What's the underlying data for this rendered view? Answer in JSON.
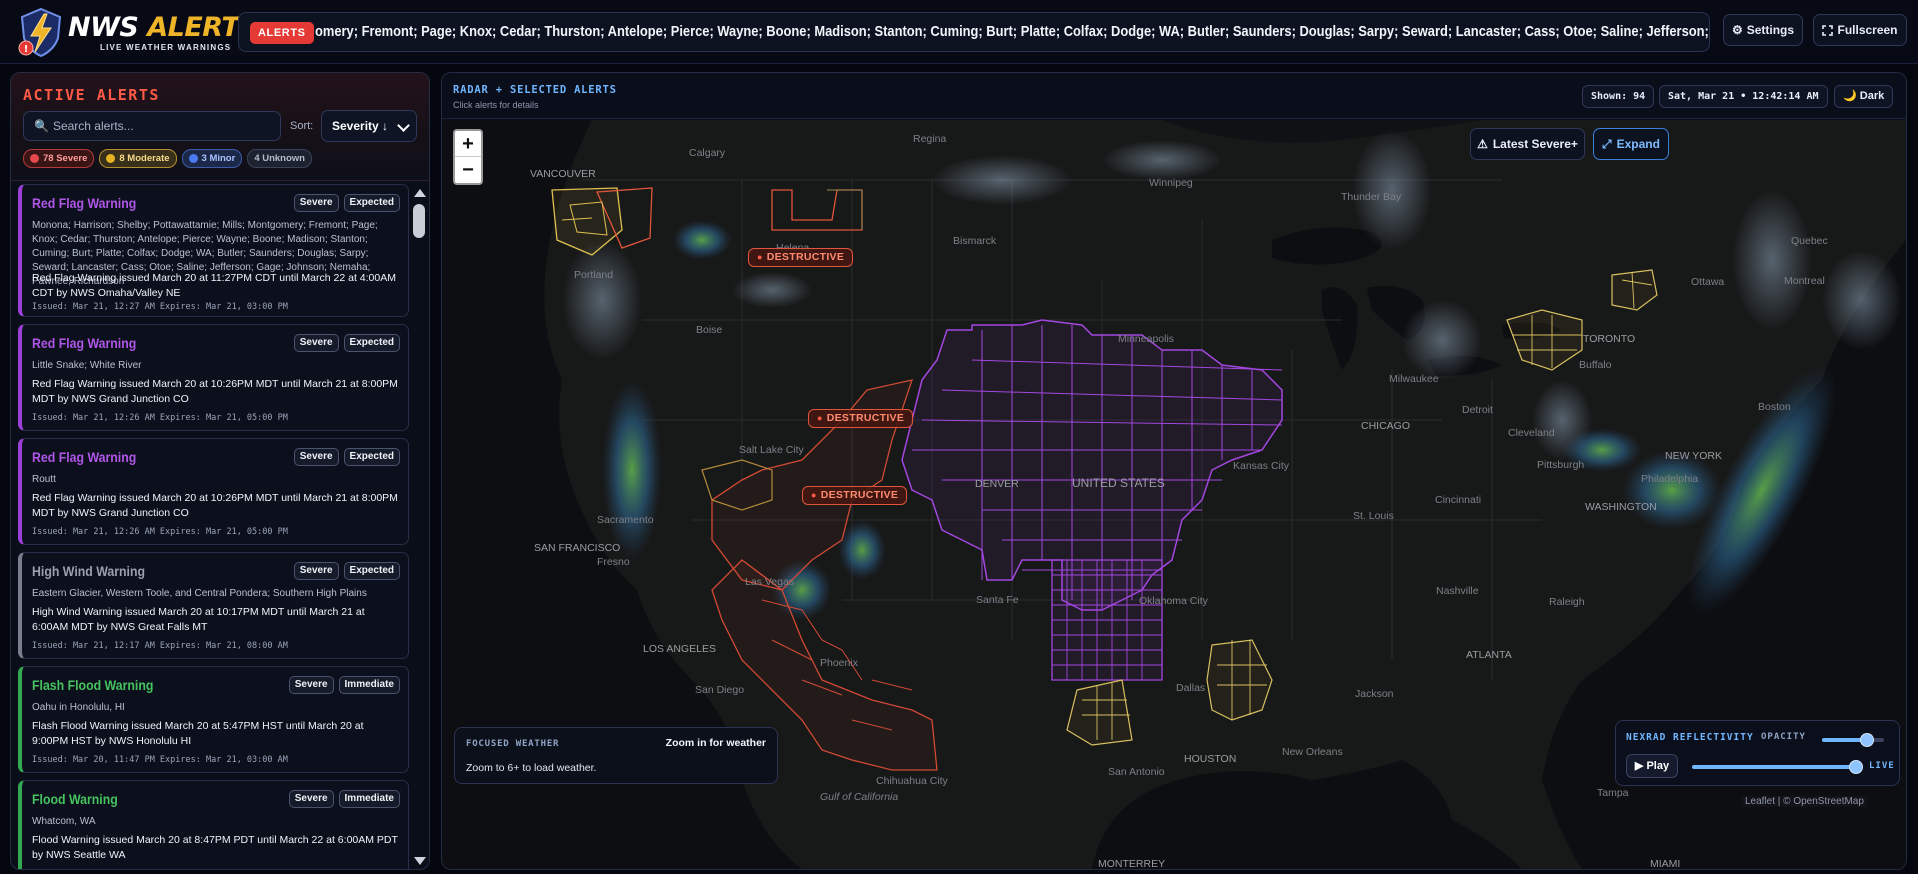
{
  "header": {
    "logo_word1": "NWS",
    "logo_word2": "ALERTS",
    "logo_subtitle": "LIVE WEATHER WARNINGS",
    "ticker_badge": "ALERTS",
    "ticker_text": "omery; Fremont; Page; Knox; Cedar; Thurston; Antelope; Pierce; Wayne; Boone; Madison; Stanton; Cuming; Burt; Platte; Colfax; Dodge; WA; Butler; Saunders; Douglas; Sarpy; Seward; Lancaster; Cass; Otoe; Saline; Jefferson; Gage; Johnson; Nemaha; Pa",
    "settings_label": "Settings",
    "fullscreen_label": "Fullscreen"
  },
  "sidebar": {
    "title": "ACTIVE ALERTS",
    "search_placeholder": "Search alerts...",
    "sort_label": "Sort:",
    "sort_value": "Severity ↓",
    "counts": [
      {
        "label": "78 Severe",
        "color": "#e5484d"
      },
      {
        "label": "8 Moderate",
        "color": "#e6b422"
      },
      {
        "label": "3 Minor",
        "color": "#4a7bf0"
      },
      {
        "label": "4 Unknown",
        "color": ""
      }
    ],
    "alerts": [
      {
        "title": "Red Flag Warning",
        "severity": "Severe",
        "urgency": "Expected",
        "areas": "Monona; Harrison; Shelby; Pottawattamie; Mills; Montgomery; Fremont; Page; Knox; Cedar; Thurston; Antelope; Pierce; Wayne; Boone; Madison; Stanton; Cuming; Burt; Platte; Colfax; Dodge; WA; Butler; Saunders; Douglas; Sarpy; Seward; Lancaster; Cass; Otoe; Saline; Jefferson; Gage; Johnson; Nemaha; Pawnee; Richardson",
        "description": "Red Flag Warning issued March 20 at 11:27PM CDT until March 22 at 4:00AM CDT by NWS Omaha/Valley NE",
        "dates": "Issued: Mar 21, 12:27 AM Expires: Mar 21, 03:00 PM"
      },
      {
        "title": "Red Flag Warning",
        "severity": "Severe",
        "urgency": "Expected",
        "areas": "Little Snake; White River",
        "description": "Red Flag Warning issued March 20 at 10:26PM MDT until March 21 at 8:00PM MDT by NWS Grand Junction CO",
        "dates": "Issued: Mar 21, 12:26 AM Expires: Mar 21, 05:00 PM"
      },
      {
        "title": "Red Flag Warning",
        "severity": "Severe",
        "urgency": "Expected",
        "areas": "Routt",
        "description": "Red Flag Warning issued March 20 at 10:26PM MDT until March 21 at 8:00PM MDT by NWS Grand Junction CO",
        "dates": "Issued: Mar 21, 12:26 AM Expires: Mar 21, 05:00 PM"
      },
      {
        "title": "High Wind Warning",
        "severity": "Severe",
        "urgency": "Expected",
        "areas": "Eastern Glacier, Western Toole, and Central Pondera; Southern High Plains",
        "description": "High Wind Warning issued March 20 at 10:17PM MDT until March 21 at 6:00AM MDT by NWS Great Falls MT",
        "dates": "Issued: Mar 21, 12:17 AM Expires: Mar 21, 08:00 AM"
      },
      {
        "title": "Flash Flood Warning",
        "severity": "Severe",
        "urgency": "Immediate",
        "areas": "Oahu in Honolulu, HI",
        "description": "Flash Flood Warning issued March 20 at 5:47PM HST until March 20 at 9:00PM HST by NWS Honolulu HI",
        "dates": "Issued: Mar 20, 11:47 PM Expires: Mar 21, 03:00 AM"
      },
      {
        "title": "Flood Warning",
        "severity": "Severe",
        "urgency": "Immediate",
        "areas": "Whatcom, WA",
        "description": "Flood Warning issued March 20 at 8:47PM PDT until March 22 at 6:00AM PDT by NWS Seattle WA",
        "dates": ""
      }
    ]
  },
  "map_panel": {
    "title": "RADAR + SELECTED ALERTS",
    "subtitle": "Click alerts for details",
    "shown": "Shown: 94",
    "datetime": "Sat, Mar 21 • 12:42:14 AM",
    "theme": "Dark",
    "zoom_in": "+",
    "zoom_out": "−",
    "latest_severe": "Latest Severe+",
    "expand": "Expand",
    "destructive_label": "DESTRUCTIVE",
    "focused_title": "FOCUSED WEATHER",
    "focused_hint": "Zoom in for weather",
    "focused_msg": "Zoom to 6+ to load weather.",
    "nexrad_title": "NEXRAD REFLECTIVITY",
    "opacity_label": "OPACITY",
    "opacity_value": 0.72,
    "play_label": "Play",
    "live_label": "LIVE",
    "timeline_value": 1.0,
    "attribution": "Leaflet | © OpenStreetMap",
    "places": [
      {
        "name": "Regina"
      },
      {
        "name": "Winnipeg"
      },
      {
        "name": "VANCOUVER"
      },
      {
        "name": "Calgary"
      },
      {
        "name": "Portland"
      },
      {
        "name": "Helena"
      },
      {
        "name": "Bismarck"
      },
      {
        "name": "Thunder Bay"
      },
      {
        "name": "Minneapolis"
      },
      {
        "name": "Quebec"
      },
      {
        "name": "Montreal"
      },
      {
        "name": "Ottawa"
      },
      {
        "name": "TORONTO"
      },
      {
        "name": "Buffalo"
      },
      {
        "name": "Boston"
      },
      {
        "name": "Boise"
      },
      {
        "name": "Milwaukee"
      },
      {
        "name": "Detroit"
      },
      {
        "name": "CHICAGO"
      },
      {
        "name": "Cleveland"
      },
      {
        "name": "NEW YORK"
      },
      {
        "name": "Pittsburgh"
      },
      {
        "name": "Philadelphia"
      },
      {
        "name": "Salt Lake City"
      },
      {
        "name": "DENVER"
      },
      {
        "name": "UNITED STATES"
      },
      {
        "name": "Sacramento"
      },
      {
        "name": "SAN FRANCISCO"
      },
      {
        "name": "Fresno"
      },
      {
        "name": "Kansas City"
      },
      {
        "name": "St. Louis"
      },
      {
        "name": "Cincinnati"
      },
      {
        "name": "WASHINGTON"
      },
      {
        "name": "Las Vegas"
      },
      {
        "name": "Santa Fe"
      },
      {
        "name": "Nashville"
      },
      {
        "name": "Raleigh"
      },
      {
        "name": "LOS ANGELES"
      },
      {
        "name": "Oklahoma City"
      },
      {
        "name": "Phoenix"
      },
      {
        "name": "ATLANTA"
      },
      {
        "name": "San Diego"
      },
      {
        "name": "Dallas"
      },
      {
        "name": "Jackson"
      },
      {
        "name": "Chihuahua City"
      },
      {
        "name": "San Antonio"
      },
      {
        "name": "HOUSTON"
      },
      {
        "name": "New Orleans"
      },
      {
        "name": "Tampa"
      },
      {
        "name": "Gulf of California"
      },
      {
        "name": "MONTERREY"
      },
      {
        "name": "MIAMI"
      }
    ]
  }
}
